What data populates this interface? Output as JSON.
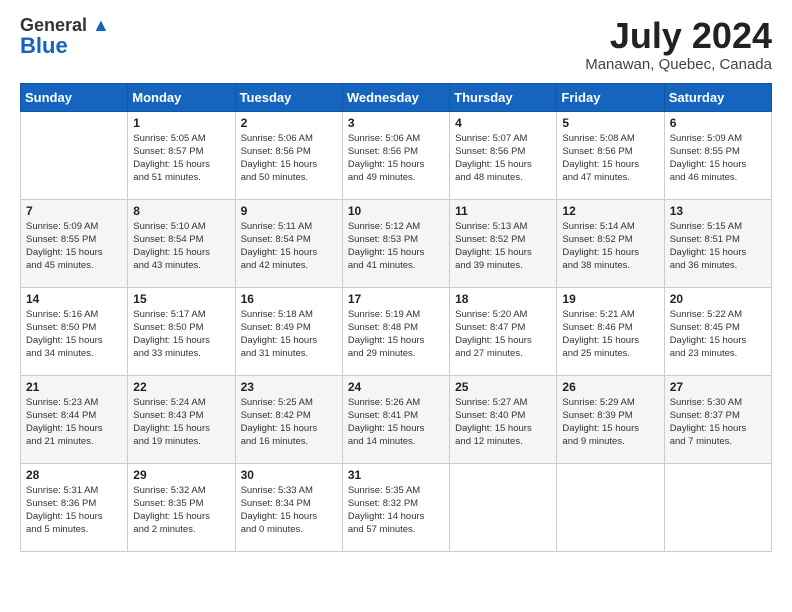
{
  "header": {
    "logo_line1": "General",
    "logo_line2": "Blue",
    "month_title": "July 2024",
    "location": "Manawan, Quebec, Canada"
  },
  "weekdays": [
    "Sunday",
    "Monday",
    "Tuesday",
    "Wednesday",
    "Thursday",
    "Friday",
    "Saturday"
  ],
  "weeks": [
    [
      {
        "day": "",
        "info": ""
      },
      {
        "day": "1",
        "info": "Sunrise: 5:05 AM\nSunset: 8:57 PM\nDaylight: 15 hours\nand 51 minutes."
      },
      {
        "day": "2",
        "info": "Sunrise: 5:06 AM\nSunset: 8:56 PM\nDaylight: 15 hours\nand 50 minutes."
      },
      {
        "day": "3",
        "info": "Sunrise: 5:06 AM\nSunset: 8:56 PM\nDaylight: 15 hours\nand 49 minutes."
      },
      {
        "day": "4",
        "info": "Sunrise: 5:07 AM\nSunset: 8:56 PM\nDaylight: 15 hours\nand 48 minutes."
      },
      {
        "day": "5",
        "info": "Sunrise: 5:08 AM\nSunset: 8:56 PM\nDaylight: 15 hours\nand 47 minutes."
      },
      {
        "day": "6",
        "info": "Sunrise: 5:09 AM\nSunset: 8:55 PM\nDaylight: 15 hours\nand 46 minutes."
      }
    ],
    [
      {
        "day": "7",
        "info": "Sunrise: 5:09 AM\nSunset: 8:55 PM\nDaylight: 15 hours\nand 45 minutes."
      },
      {
        "day": "8",
        "info": "Sunrise: 5:10 AM\nSunset: 8:54 PM\nDaylight: 15 hours\nand 43 minutes."
      },
      {
        "day": "9",
        "info": "Sunrise: 5:11 AM\nSunset: 8:54 PM\nDaylight: 15 hours\nand 42 minutes."
      },
      {
        "day": "10",
        "info": "Sunrise: 5:12 AM\nSunset: 8:53 PM\nDaylight: 15 hours\nand 41 minutes."
      },
      {
        "day": "11",
        "info": "Sunrise: 5:13 AM\nSunset: 8:52 PM\nDaylight: 15 hours\nand 39 minutes."
      },
      {
        "day": "12",
        "info": "Sunrise: 5:14 AM\nSunset: 8:52 PM\nDaylight: 15 hours\nand 38 minutes."
      },
      {
        "day": "13",
        "info": "Sunrise: 5:15 AM\nSunset: 8:51 PM\nDaylight: 15 hours\nand 36 minutes."
      }
    ],
    [
      {
        "day": "14",
        "info": "Sunrise: 5:16 AM\nSunset: 8:50 PM\nDaylight: 15 hours\nand 34 minutes."
      },
      {
        "day": "15",
        "info": "Sunrise: 5:17 AM\nSunset: 8:50 PM\nDaylight: 15 hours\nand 33 minutes."
      },
      {
        "day": "16",
        "info": "Sunrise: 5:18 AM\nSunset: 8:49 PM\nDaylight: 15 hours\nand 31 minutes."
      },
      {
        "day": "17",
        "info": "Sunrise: 5:19 AM\nSunset: 8:48 PM\nDaylight: 15 hours\nand 29 minutes."
      },
      {
        "day": "18",
        "info": "Sunrise: 5:20 AM\nSunset: 8:47 PM\nDaylight: 15 hours\nand 27 minutes."
      },
      {
        "day": "19",
        "info": "Sunrise: 5:21 AM\nSunset: 8:46 PM\nDaylight: 15 hours\nand 25 minutes."
      },
      {
        "day": "20",
        "info": "Sunrise: 5:22 AM\nSunset: 8:45 PM\nDaylight: 15 hours\nand 23 minutes."
      }
    ],
    [
      {
        "day": "21",
        "info": "Sunrise: 5:23 AM\nSunset: 8:44 PM\nDaylight: 15 hours\nand 21 minutes."
      },
      {
        "day": "22",
        "info": "Sunrise: 5:24 AM\nSunset: 8:43 PM\nDaylight: 15 hours\nand 19 minutes."
      },
      {
        "day": "23",
        "info": "Sunrise: 5:25 AM\nSunset: 8:42 PM\nDaylight: 15 hours\nand 16 minutes."
      },
      {
        "day": "24",
        "info": "Sunrise: 5:26 AM\nSunset: 8:41 PM\nDaylight: 15 hours\nand 14 minutes."
      },
      {
        "day": "25",
        "info": "Sunrise: 5:27 AM\nSunset: 8:40 PM\nDaylight: 15 hours\nand 12 minutes."
      },
      {
        "day": "26",
        "info": "Sunrise: 5:29 AM\nSunset: 8:39 PM\nDaylight: 15 hours\nand 9 minutes."
      },
      {
        "day": "27",
        "info": "Sunrise: 5:30 AM\nSunset: 8:37 PM\nDaylight: 15 hours\nand 7 minutes."
      }
    ],
    [
      {
        "day": "28",
        "info": "Sunrise: 5:31 AM\nSunset: 8:36 PM\nDaylight: 15 hours\nand 5 minutes."
      },
      {
        "day": "29",
        "info": "Sunrise: 5:32 AM\nSunset: 8:35 PM\nDaylight: 15 hours\nand 2 minutes."
      },
      {
        "day": "30",
        "info": "Sunrise: 5:33 AM\nSunset: 8:34 PM\nDaylight: 15 hours\nand 0 minutes."
      },
      {
        "day": "31",
        "info": "Sunrise: 5:35 AM\nSunset: 8:32 PM\nDaylight: 14 hours\nand 57 minutes."
      },
      {
        "day": "",
        "info": ""
      },
      {
        "day": "",
        "info": ""
      },
      {
        "day": "",
        "info": ""
      }
    ]
  ]
}
